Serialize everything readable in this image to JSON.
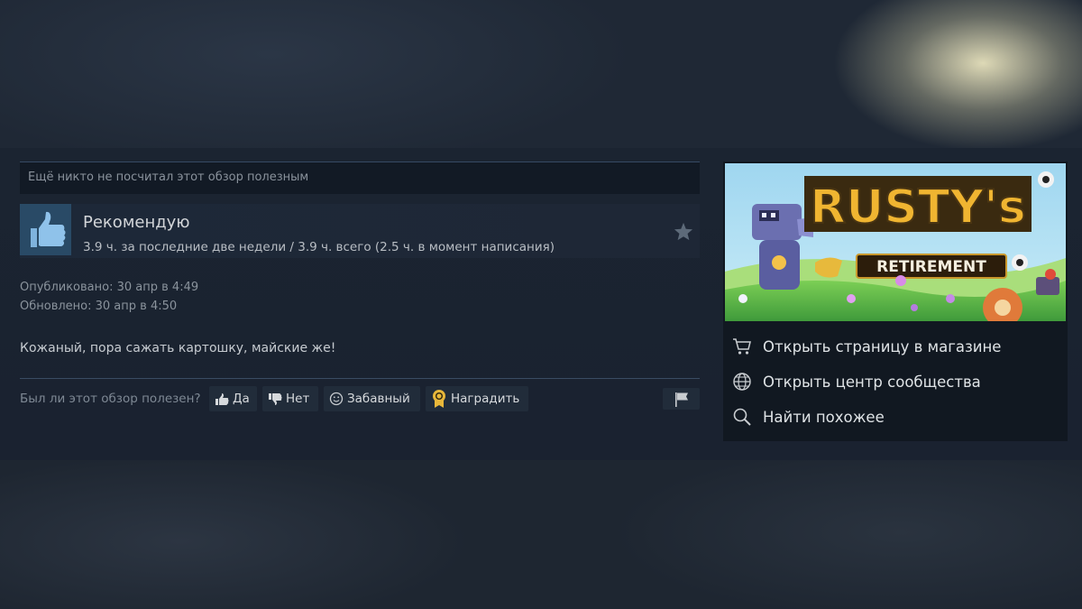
{
  "review": {
    "helpful_status": "Ещё никто не посчитал этот обзор полезным",
    "verdict": "Рекомендую",
    "hours": "3.9 ч. за последние две недели / 3.9 ч. всего (2.5 ч. в момент написания)",
    "posted": "Опубликовано: 30 апр в 4:49",
    "updated": "Обновлено: 30 апр в 4:50",
    "text": "Кожаный, пора сажать картошку, майские же!",
    "icons": {
      "verdict": "thumbs-up-icon",
      "favorite": "star-icon",
      "report": "flag-icon"
    }
  },
  "vote": {
    "question": "Был ли этот обзор полезен?",
    "yes": "Да",
    "no": "Нет",
    "funny": "Забавный",
    "award": "Наградить"
  },
  "game": {
    "logo_line1": "RUSTY's",
    "logo_line2": "RETIREMENT",
    "links": [
      {
        "label": "Открыть страницу в магазине",
        "icon": "cart-icon"
      },
      {
        "label": "Открыть центр сообщества",
        "icon": "globe-icon"
      },
      {
        "label": "Найти похожее",
        "icon": "search-icon"
      }
    ]
  },
  "colors": {
    "verdict_icon_bg": "#294a66",
    "panel_bg": "#111821",
    "award_gold": "#e8b73a"
  }
}
